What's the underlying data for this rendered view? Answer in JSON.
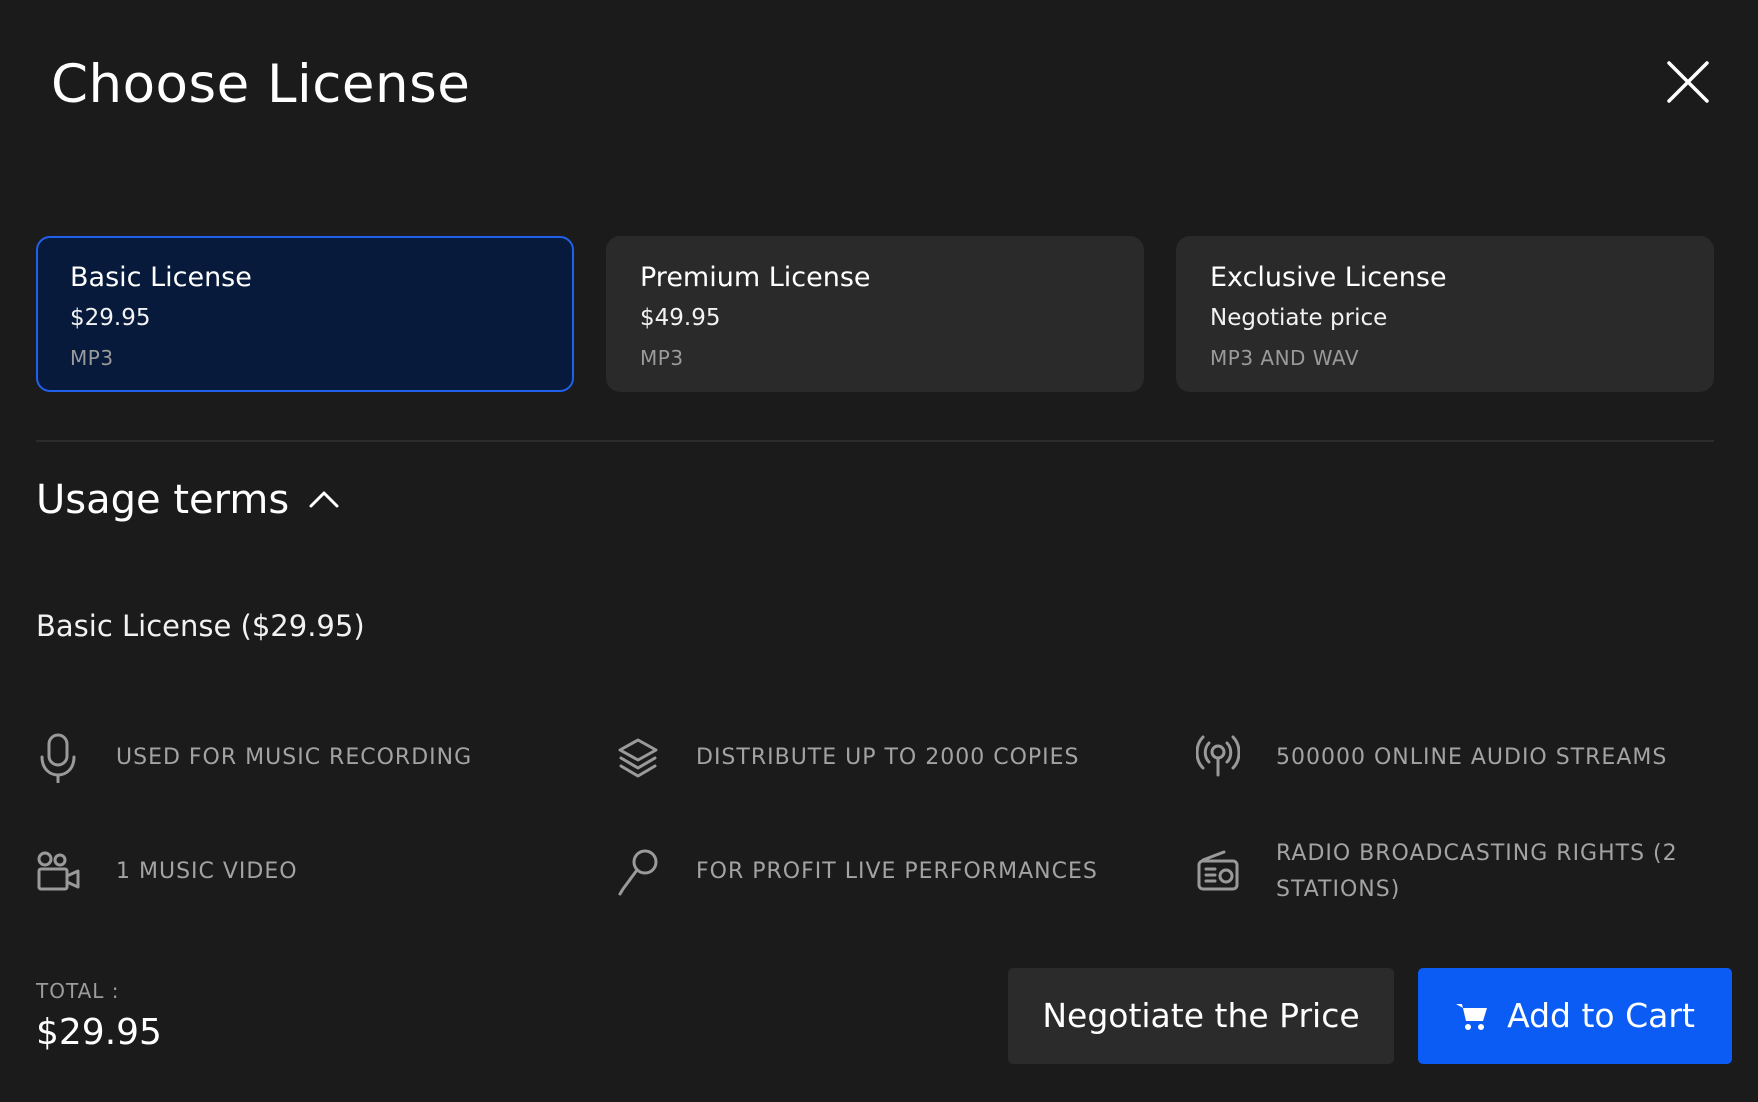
{
  "modal": {
    "title": "Choose License"
  },
  "licenses": [
    {
      "name": "Basic License",
      "price": "$29.95",
      "format": "MP3",
      "selected": true
    },
    {
      "name": "Premium License",
      "price": "$49.95",
      "format": "MP3",
      "selected": false
    },
    {
      "name": "Exclusive License",
      "price": "Negotiate price",
      "format": "MP3 AND WAV",
      "selected": false
    }
  ],
  "usage": {
    "title": "Usage terms",
    "selected_summary": "Basic License ($29.95)",
    "terms": [
      {
        "icon": "microphone-icon",
        "text": "USED FOR MUSIC RECORDING"
      },
      {
        "icon": "layers-icon",
        "text": "DISTRIBUTE UP TO 2000 COPIES"
      },
      {
        "icon": "broadcast-icon",
        "text": "500000 ONLINE AUDIO STREAMS"
      },
      {
        "icon": "video-camera-icon",
        "text": "1 MUSIC VIDEO"
      },
      {
        "icon": "live-microphone-icon",
        "text": "FOR PROFIT LIVE PERFORMANCES"
      },
      {
        "icon": "radio-icon",
        "text": "RADIO BROADCASTING RIGHTS (2 STATIONS)"
      }
    ]
  },
  "footer": {
    "total_label": "TOTAL :",
    "total_value": "$29.95",
    "negotiate_label": "Negotiate the Price",
    "cart_label": "Add to Cart"
  },
  "colors": {
    "background": "#1b1b1c",
    "selected_card": "#071a3b",
    "accent": "#0b5cf5"
  }
}
